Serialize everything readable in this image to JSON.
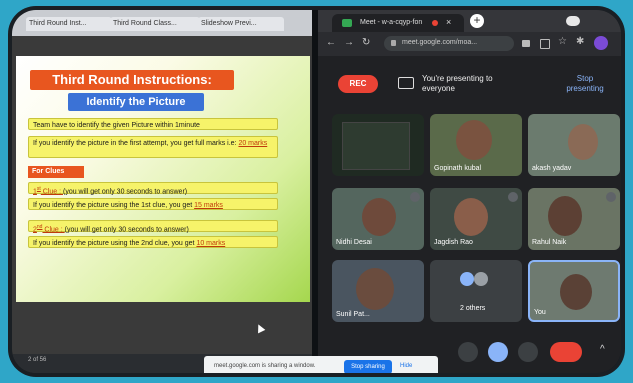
{
  "left_window": {
    "tabs": [
      "Third Round Inst...",
      "Third Round Class...",
      "Slideshow Previ..."
    ],
    "bottom_text": "2 of 56"
  },
  "slide": {
    "title": "Third Round Instructions:",
    "subtitle": "Identify the Picture",
    "rule1": "Team have to identify the given Picture within 1minute",
    "rule2_a": "If you identify the picture in the first attempt, you get full marks i.e: ",
    "rule2_marks": "20 marks",
    "for_clues": "For Clues",
    "clue1_a": "1",
    "clue1_sup": "st",
    "clue1_b": " Clue : ",
    "clue1_c": "(you will get only 30 seconds to answer)",
    "clue1_rule": "If you identify the picture using the 1st clue, you get ",
    "clue1_marks": "15 marks",
    "clue2_a": "2",
    "clue2_sup": "nd",
    "clue2_b": " Clue : ",
    "clue2_c": "(you will get only 30 seconds to answer)",
    "clue2_rule": "If you identify the picture using the 2nd clue, you get ",
    "clue2_marks": "10 marks"
  },
  "meet": {
    "tab_label": "Meet - w-a-cqyp-fon",
    "url": "meet.google.com/moa...",
    "rec_label": "REC",
    "presenting_text": "You're presenting to everyone",
    "stop_presenting": "Stop presenting",
    "participants": [
      {
        "name": ""
      },
      {
        "name": "Gopinath kubal"
      },
      {
        "name": "akash yadav"
      },
      {
        "name": "Nidhi Desai"
      },
      {
        "name": "Jagdish Rao"
      },
      {
        "name": "Rahul Naik"
      },
      {
        "name": "Sunil Pat..."
      },
      {
        "name": "2 others"
      },
      {
        "name": "You"
      }
    ]
  },
  "share_notice": {
    "text": "meet.google.com is sharing a window.",
    "stop_label": "Stop sharing",
    "hide_label": "Hide"
  },
  "colors": {
    "slide_title_bg": "#e8561f",
    "subtitle_bg": "#3b72d6",
    "box_bg": "#f6f36a",
    "rec_bg": "#ea4335",
    "stop_share_bg": "#1a73e8"
  }
}
